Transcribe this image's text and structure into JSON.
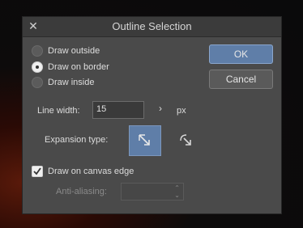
{
  "dialog": {
    "title": "Outline Selection",
    "close_icon": "close-icon"
  },
  "position": {
    "options": [
      {
        "label": "Draw outside",
        "selected": false
      },
      {
        "label": "Draw on border",
        "selected": true
      },
      {
        "label": "Draw inside",
        "selected": false
      }
    ]
  },
  "buttons": {
    "ok": "OK",
    "cancel": "Cancel"
  },
  "line_width": {
    "label": "Line width:",
    "value": "15",
    "unit": "px",
    "chevron_icon": "chevron-right-icon"
  },
  "expansion": {
    "label": "Expansion type:",
    "options": [
      {
        "icon": "expand-square-corner-icon",
        "selected": true
      },
      {
        "icon": "expand-round-corner-icon",
        "selected": false
      }
    ]
  },
  "canvas_edge": {
    "label": "Draw on canvas edge",
    "checked": true
  },
  "anti_aliasing": {
    "label": "Anti-aliasing:",
    "value": "",
    "enabled": false
  },
  "colors": {
    "accent": "#5f7ea8",
    "dialog_bg": "#4a4a4a"
  }
}
